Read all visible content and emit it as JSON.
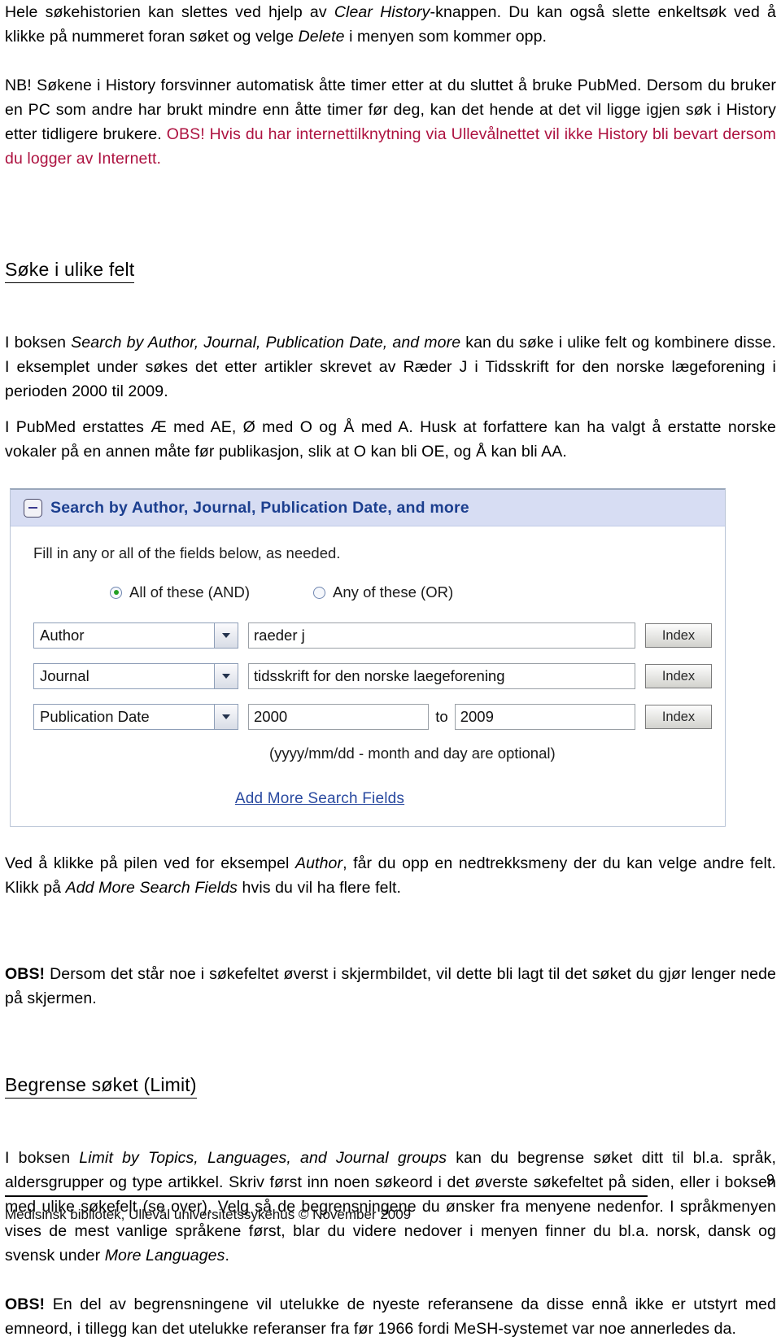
{
  "document": {
    "page_number": "9",
    "footer": "Medisinsk bibliotek, Ullevål universitetssykehus  ©   November 2009"
  },
  "paragraphs": {
    "p1_a": "Hele søkehistorien kan slettes ved hjelp av ",
    "p1_em1": "Clear History",
    "p1_b": "-knappen. Du kan også slette enkeltsøk ved å klikke på nummeret foran søket og velge ",
    "p1_em2": "Delete",
    "p1_c": " i menyen som kommer opp.",
    "p2_a": "NB! Søkene i History forsvinner automatisk åtte timer etter at du sluttet å bruke PubMed. Dersom du bruker en PC som andre har brukt mindre enn åtte timer før deg, kan det hende at det vil ligge igjen søk i History etter tidligere brukere. ",
    "p2_red": "OBS! Hvis du har internettilknytning via Ullevålnettet vil ikke History bli bevart dersom du logger av Internett.",
    "p3_a": "I boksen ",
    "p3_em": "Search by Author, Journal, Publication Date, and more",
    "p3_b": " kan du søke i ulike felt og kombinere disse. I eksemplet under søkes det etter artikler skrevet av Ræder J i Tidsskrift for den norske lægeforening i perioden 2000 til 2009.",
    "p4": "I PubMed erstattes Æ med AE, Ø med O og Å med A. Husk at forfattere kan ha valgt å erstatte norske vokaler på en annen måte før publikasjon, slik at O kan bli OE, og Å kan bli AA.",
    "p5_a": "Ved å klikke på pilen ved for eksempel ",
    "p5_em1": "Author",
    "p5_b": ", får du opp en nedtrekksmeny der du kan velge andre felt. Klikk på ",
    "p5_em2": "Add More Search Fields",
    "p5_c": " hvis du vil ha flere felt.",
    "p6_bold": "OBS!",
    "p6_rest": " Dersom det står noe i søkefeltet øverst i skjermbildet, vil dette bli lagt til det søket du gjør lenger nede på skjermen.",
    "p7_a": "I boksen ",
    "p7_em1": "Limit by Topics, Languages, and Journal groups",
    "p7_b": " kan du begrense søket ditt til bl.a. språk, aldersgrupper og type artikkel. Skriv først inn noen søkeord i det øverste søkefeltet på siden, eller i boksen med ulike søkefelt (se over). Velg så de begrensningene du ønsker fra menyene nedenfor. I språkmenyen vises de mest vanlige språkene først, blar du videre nedover i menyen finner du bl.a. norsk, dansk og svensk under ",
    "p7_em2": "More Languages",
    "p7_c": ".",
    "p8_bold": "OBS!",
    "p8_rest": " En del av begrensningene vil utelukke de nyeste referansene da disse ennå ikke er utstyrt med emneord, i tillegg kan det utelukke referanser fra før 1966 fordi MeSH-systemet var noe annerledes da."
  },
  "headings": {
    "h1": "Søke i ulike felt",
    "h2": "Begrense søket (Limit)"
  },
  "screenshot": {
    "title": "Search by Author, Journal, Publication Date, and more",
    "collapse_icon": "minus-icon",
    "fill_note": "Fill in any or all of the fields below, as needed.",
    "radios": [
      {
        "label": "All of these (AND)",
        "selected": true
      },
      {
        "label": "Any of these (OR)",
        "selected": false
      }
    ],
    "rows": [
      {
        "select": "Author",
        "value": "raeder j",
        "button": "Index"
      },
      {
        "select": "Journal",
        "value": "tidsskrift for den norske laegeforening",
        "button": "Index"
      },
      {
        "select": "Publication Date",
        "value": "2000",
        "to": "to",
        "value2": "2009",
        "button": "Index"
      }
    ],
    "date_hint": "(yyyy/mm/dd - month and day are optional)",
    "add_fields_link": "Add More Search Fields"
  },
  "colors": {
    "accent_red": "#ad1240",
    "header_blue_bg": "#d7ddf3",
    "header_blue_text": "#1c3f8f",
    "link_blue": "#2a4aa0",
    "radio_on_green": "#23a023"
  }
}
